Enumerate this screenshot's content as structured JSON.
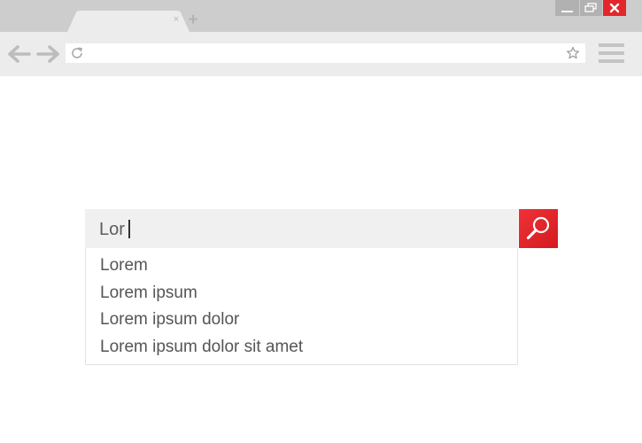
{
  "window": {
    "minimize_icon": "minimize-icon",
    "maximize_icon": "restore-icon",
    "close_icon": "close-icon",
    "close_color": "#e2262c"
  },
  "tabs": [
    {
      "label": "",
      "close_glyph": "×"
    }
  ],
  "tab_strip": {
    "new_tab_glyph": "+"
  },
  "toolbar": {
    "address_value": "",
    "back_icon": "arrow-left-icon",
    "forward_icon": "arrow-right-icon",
    "reload_icon": "reload-icon",
    "bookmark_icon": "star-icon",
    "menu_icon": "hamburger-menu-icon"
  },
  "search": {
    "query": "Lor",
    "button_icon": "magnifier-icon",
    "button_color": "#e2262c",
    "suggestions": [
      "Lorem",
      "Lorem ipsum",
      "Lorem ipsum dolor",
      "Lorem ipsum dolor sit amet"
    ]
  }
}
